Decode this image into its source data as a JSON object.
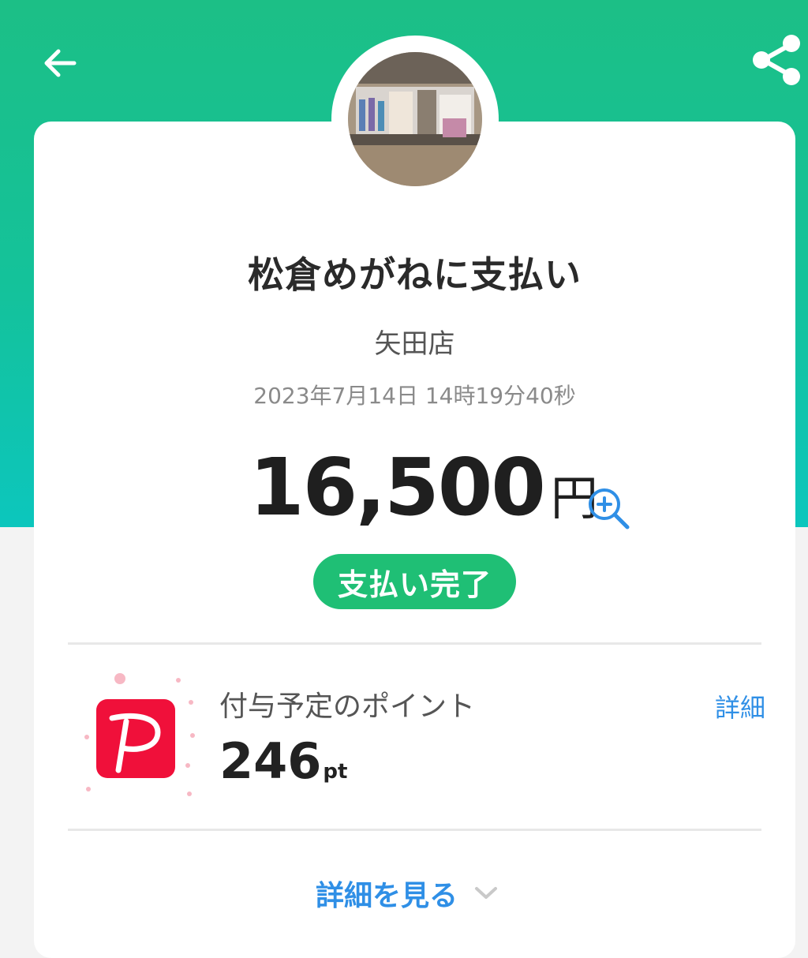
{
  "header": {
    "back_icon": "arrow-left-icon",
    "share_icon": "share-icon",
    "colors": {
      "gradient_top": "#1cbf86",
      "gradient_bottom": "#0cc6bd"
    }
  },
  "payment": {
    "title": "松倉めがねに支払い",
    "branch": "矢田店",
    "datetime": "2023年7月14日 14時19分40秒",
    "amount": "16,500",
    "currency": "円",
    "status": "支払い完了",
    "status_color": "#1fbf75"
  },
  "points": {
    "logo_icon": "paypay-logo-icon",
    "label": "付与予定のポイント",
    "value": "246",
    "unit": "pt",
    "detail_link": "詳細",
    "brand_color": "#f0103a"
  },
  "footer": {
    "see_details_label": "詳細を見る",
    "link_color": "#2f8fe6"
  }
}
